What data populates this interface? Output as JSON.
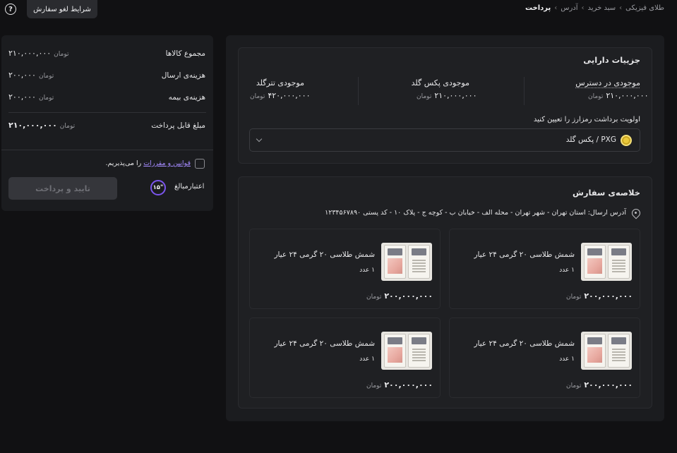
{
  "topbar": {
    "help_glyph": "?",
    "cancel_terms_label": "شرایط لغو سفارش",
    "breadcrumb": {
      "items": [
        "طلای فیزیکی",
        "سبد خرید",
        "آدرس",
        "پرداخت"
      ],
      "separator": "›"
    }
  },
  "summary": {
    "rows": [
      {
        "label": "مجموع کالاها",
        "value": "۲۱۰,۰۰۰,۰۰۰",
        "unit": "تومان"
      },
      {
        "label": "هزینه‌ی ارسال",
        "value": "۲۰۰,۰۰۰",
        "unit": "تومان"
      },
      {
        "label": "هزینه‌ی بیمه",
        "value": "۲۰۰,۰۰۰",
        "unit": "تومان"
      }
    ],
    "total": {
      "label": "مبلغ قابل پرداخت",
      "value": "۲۱۰,۰۰۰,۰۰۰",
      "unit": "تومان"
    },
    "terms": {
      "link_text": "قوانین و مقررات",
      "suffix": "را می‌پذیریم."
    },
    "validity_label": "اعتبارمبالغ",
    "timer_value": "۱۵\"",
    "pay_button_label": "تایید و پرداخت"
  },
  "asset_details": {
    "title": "جزییات دارایی",
    "balances": [
      {
        "label": "موجودی در دسترس",
        "value": "۲۱۰,۰۰۰,۰۰۰",
        "unit": "تومان"
      },
      {
        "label": "موجودی پکس گلد",
        "value": "۲۱۰,۰۰۰,۰۰۰",
        "unit": "تومان"
      },
      {
        "label": "موجودی تترگلد",
        "value": "۴۲۰,۰۰۰,۰۰۰",
        "unit": "تومان"
      }
    ],
    "priority_label": "اولویت برداشت رمزارز را تعیین کنید",
    "selected_option": "پکس گلد / PXG"
  },
  "order_summary": {
    "title": "خلاصه‌ی سفارش",
    "address_label": "آدرس ارسال:",
    "address": "استان تهران - شهر تهران - محله الف - خیابان ب - کوچه ج - پلاک ۱۰ - کد پستی ۱۲۳۴۵۶۷۸۹۰",
    "products": [
      {
        "name": "شمش طلاسی ۲۰ گرمی ۲۴ عیار",
        "qty": "۱ عدد",
        "price": "۲۰۰,۰۰۰,۰۰۰",
        "unit": "تومان"
      },
      {
        "name": "شمش طلاسی ۲۰ گرمی ۲۴ عیار",
        "qty": "۱ عدد",
        "price": "۲۰۰,۰۰۰,۰۰۰",
        "unit": "تومان"
      },
      {
        "name": "شمش طلاسی ۲۰ گرمی ۲۴ عیار",
        "qty": "۱ عدد",
        "price": "۲۰۰,۰۰۰,۰۰۰",
        "unit": "تومان"
      },
      {
        "name": "شمش طلاسی ۲۰ گرمی ۲۴ عیار",
        "qty": "۱ عدد",
        "price": "۲۰۰,۰۰۰,۰۰۰",
        "unit": "تومان"
      }
    ]
  },
  "colors": {
    "background": "#111113",
    "panel": "#1b1c1f",
    "accent": "#7b55ee",
    "link": "#a58bff",
    "coin": "#e9c83a"
  }
}
